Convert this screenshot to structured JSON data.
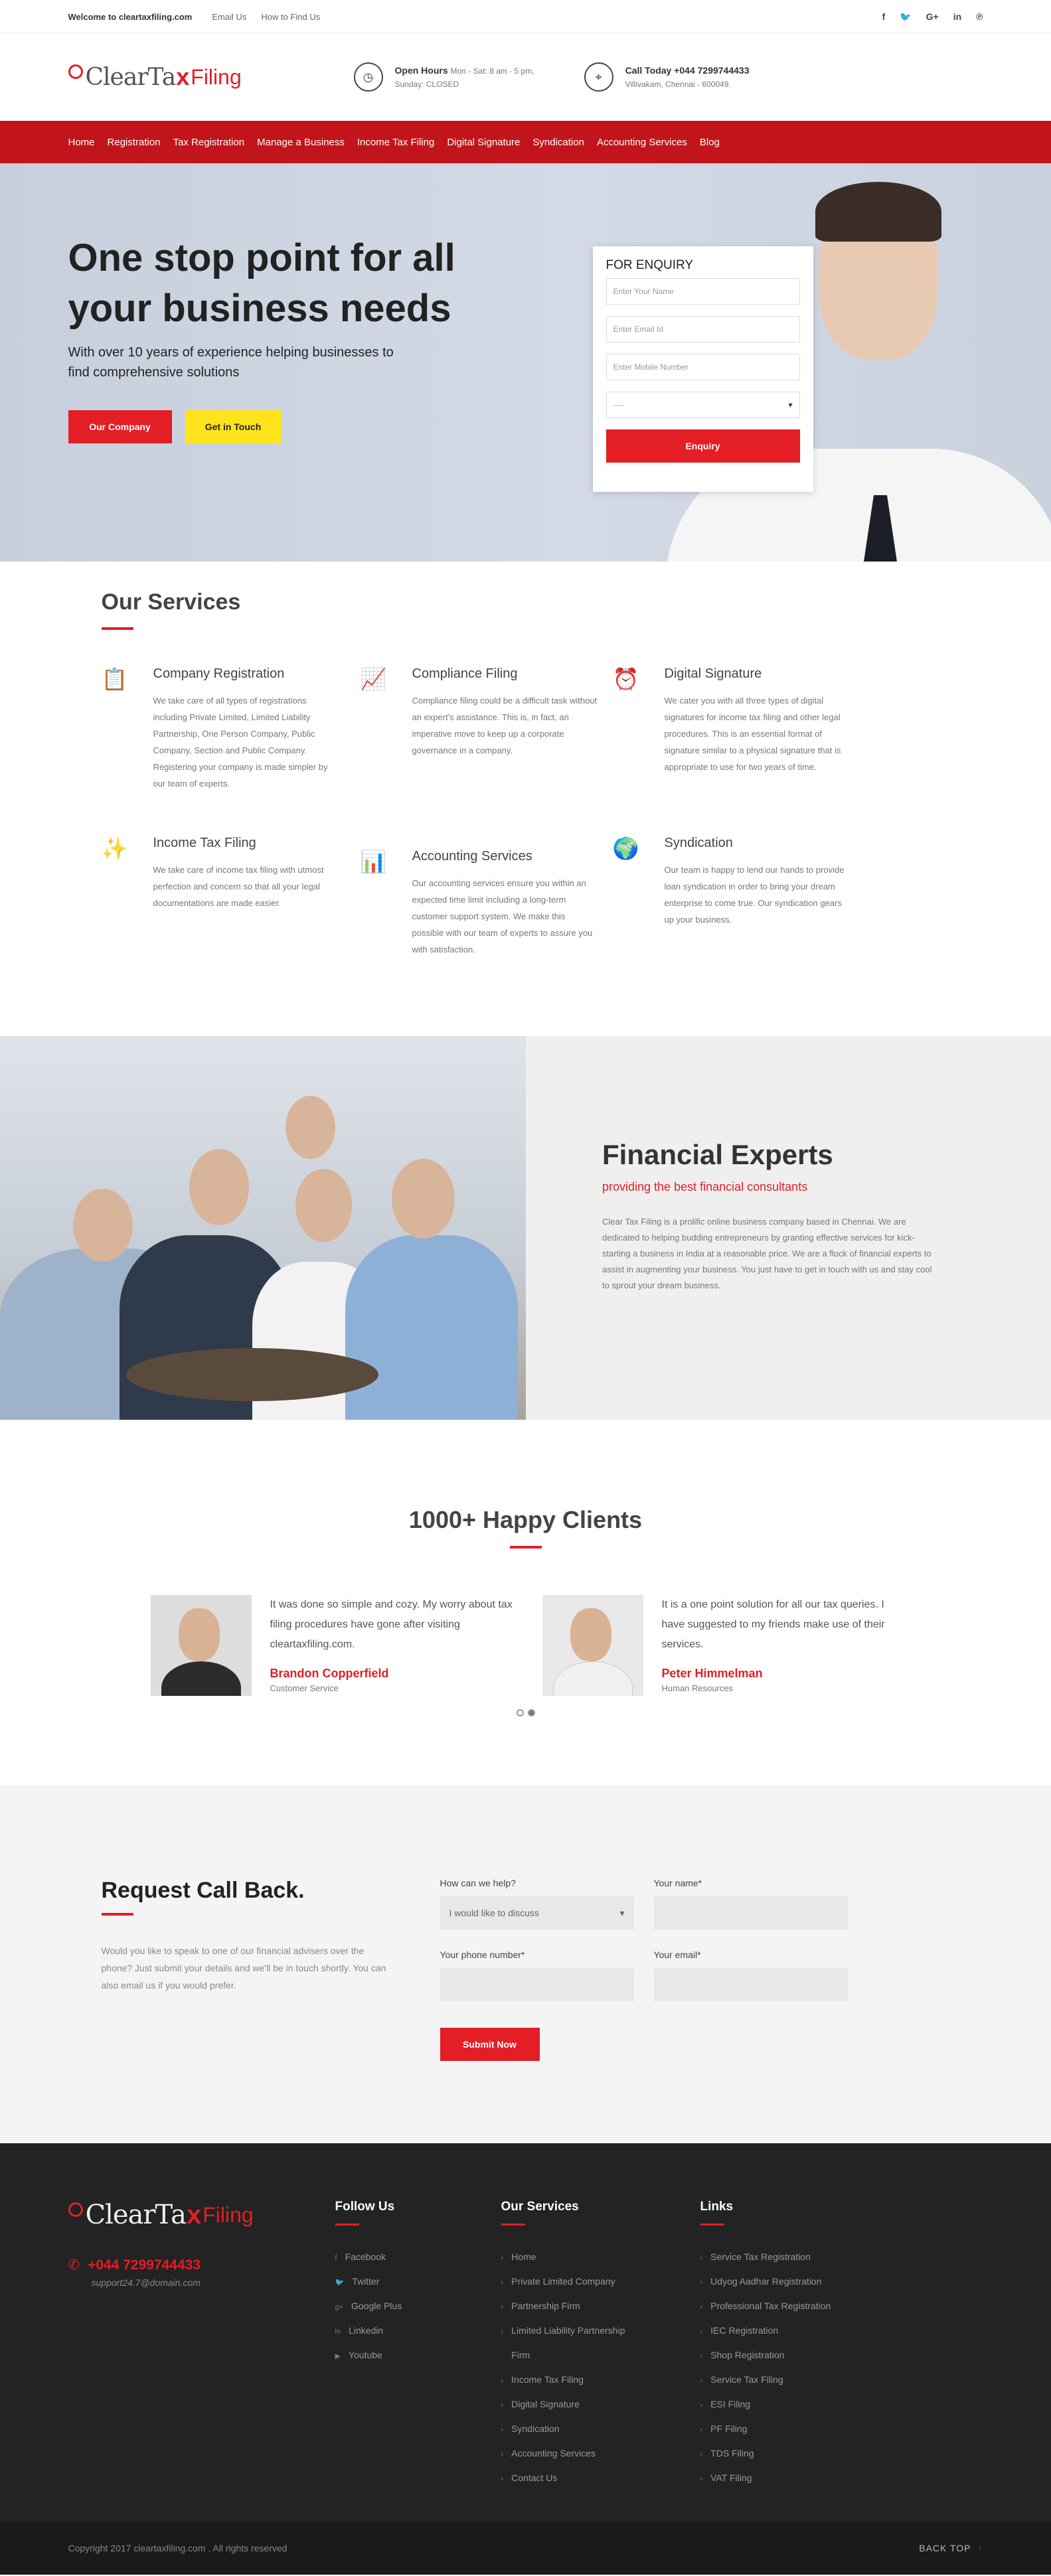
{
  "topbar": {
    "welcome": "Welcome to cleartaxfiling.com",
    "email_link": "Email Us",
    "find_link": "How to Find Us",
    "social": [
      "f",
      "🐦",
      "G+",
      "in",
      "℗"
    ]
  },
  "header": {
    "logo_clear": "Clear",
    "logo_ta": "Ta",
    "logo_x": "x",
    "logo_filing": "Filing",
    "hours_title": "Open Hours",
    "hours_text": "Mon - Sat: 8 am - 5 pm,",
    "hours_sub": "Sunday: CLOSED",
    "call_title": "Call Today +044 7299744433",
    "call_sub": "Villivakam, Chennai - 600049."
  },
  "nav": [
    "Home",
    "Registration",
    "Tax Registration",
    "Manage a Business",
    "Income Tax Filing",
    "Digital Signature",
    "Syndication",
    "Accounting Services",
    "Blog"
  ],
  "hero": {
    "title": "One stop point for all your business needs",
    "subtitle": "With over 10 years of experience helping businesses to find comprehensive solutions",
    "btn_company": "Our Company",
    "btn_touch": "Get in Touch"
  },
  "enquiry": {
    "title": "FOR ENQUIRY",
    "name_ph": "Enter Your Name",
    "email_ph": "Enter Email Id",
    "mobile_ph": "Enter Mobile Number",
    "select_val": "----",
    "submit": "Enquiry"
  },
  "services": {
    "title": "Our Services",
    "items": [
      {
        "icon": "clipboard-icon",
        "glyph": "📋",
        "title": "Company Registration",
        "text": "We take care of all types of registrations including Private Limited, Limited Liability Partnership, One Person Company, Public Company, Section and Public Company. Registering your company is made simpler by our team of experts."
      },
      {
        "icon": "trend-up-icon",
        "glyph": "📈",
        "title": "Compliance Filing",
        "text": "Compliance filing could be a difficult task without an expert's assistance. This is, in fact, an imperative move to keep up a corporate governance in a company."
      },
      {
        "icon": "alarm-clock-icon",
        "glyph": "⏰",
        "title": "Digital Signature",
        "text": "We cater you with all three types of digital signatures for income tax filing and other legal procedures. This is an essential format of signature similar to a physical signature that is appropriate to use for two years of time."
      },
      {
        "icon": "magic-wand-icon",
        "glyph": "✨",
        "title": "Income Tax Filing",
        "text": "We take care of income tax filing with utmost perfection and concern so that all your legal documentations are made easier."
      },
      {
        "icon": "presentation-board-icon",
        "glyph": "📊",
        "title": "Accounting Services",
        "text": "Our accounting services ensure you within an expected time limit including a long-term customer support system. We make this possible with our team of experts to assure you with satisfaction."
      },
      {
        "icon": "globe-icon",
        "glyph": "🌍",
        "title": "Syndication",
        "text": "Our team is happy to lend our hands to provide loan syndication in order to bring your dream enterprise to come true. Our syndication gears up your business."
      }
    ]
  },
  "finance": {
    "title": "Financial Experts",
    "subtitle": "providing the best financial consultants",
    "text": "Clear Tax Filing is a prolific online business company based in Chennai. We are dedicated to helping budding entrepreneurs by granting effective services for kick-starting a business in India at a reasonable price. We are a flock of financial experts to assist in augmenting your business. You just have to get in touch with us and stay cool to sprout your dream business."
  },
  "clients": {
    "title": "1000+ Happy Clients",
    "items": [
      {
        "quote": "It was done so simple and cozy. My worry about tax filing procedures have gone after visiting cleartaxfiling.com.",
        "name": "Brandon Copperfield",
        "role": "Customer Service"
      },
      {
        "quote": "It is a one point solution for all our tax queries. I have suggested to my friends make use of their services.",
        "name": "Peter Himmelman",
        "role": "Human Resources"
      }
    ]
  },
  "callback": {
    "title": "Request Call Back.",
    "text": "Would you like to speak to one of our financial advisers over the phone? Just submit your details and we'll be in touch shortly. You can also email us if you would prefer.",
    "help_label": "How can we help?",
    "help_value": "I would like to discuss",
    "name_label": "Your name*",
    "phone_label": "Your phone number*",
    "email_label": "Your email*",
    "submit": "Submit Now"
  },
  "footer": {
    "phone": "+044 7299744433",
    "email": "support24.7@domain.com",
    "follow_title": "Follow Us",
    "follow": [
      {
        "icon": "facebook-icon",
        "glyph": "f",
        "label": "Facebook"
      },
      {
        "icon": "twitter-icon",
        "glyph": "🐦",
        "label": "Twitter"
      },
      {
        "icon": "google-plus-icon",
        "glyph": "g+",
        "label": "Google Plus"
      },
      {
        "icon": "linkedin-icon",
        "glyph": "in",
        "label": "Linkedin"
      },
      {
        "icon": "youtube-icon",
        "glyph": "▶",
        "label": "Youtube"
      }
    ],
    "services_title": "Our Services",
    "services": [
      "Home",
      "Private Limited Company",
      "Partnership Firm",
      "Limited Liability Partnership",
      "Firm",
      "Income Tax Filing",
      "Digital Signature",
      "Syndication",
      "Accounting Services",
      "Contact Us"
    ],
    "links_title": "Links",
    "links": [
      "Service Tax Registration",
      "Udyog Aadhar Registration",
      "Professional Tax Registration",
      "IEC Registration",
      "Shop Registration",
      "Service Tax Filing",
      "ESI Filing",
      "PF Filing",
      "TDS Filing",
      "VAT Filing"
    ],
    "copyright": "Copyright 2017 cleartaxfiling.com . All rights reserved",
    "back_top": "BACK TOP",
    "back_arrow": "↑"
  }
}
